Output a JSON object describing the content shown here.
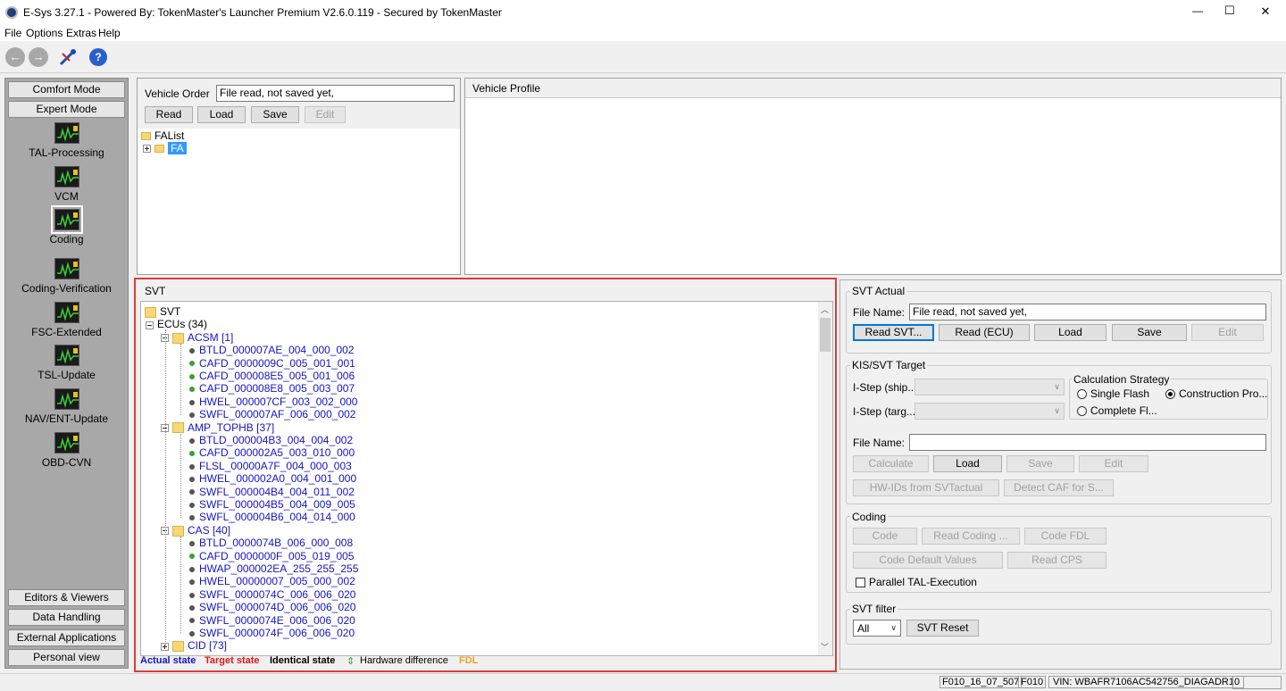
{
  "window": {
    "title": "E-Sys 3.27.1 - Powered By: TokenMaster's Launcher Premium V2.6.0.119 - Secured by TokenMaster",
    "minimize": "—",
    "maximize": "☐",
    "close": "✕"
  },
  "menu": [
    "File",
    "Options",
    "Extras",
    "Help"
  ],
  "sidebar": {
    "top_tabs": [
      "Comfort Mode",
      "Expert Mode"
    ],
    "modes": [
      "TAL-Processing",
      "VCM",
      "Coding",
      "Coding-Verification",
      "FSC-Extended",
      "TSL-Update",
      "NAV/ENT-Update",
      "OBD-CVN"
    ],
    "selected_mode": "Coding",
    "bottom_tabs": [
      "Editors & Viewers",
      "Data Handling",
      "External Applications",
      "Personal view"
    ]
  },
  "vehicle_order": {
    "label": "Vehicle Order",
    "value": "File read, not saved yet,",
    "buttons": {
      "read": "Read",
      "load": "Load",
      "save": "Save",
      "edit": "Edit"
    },
    "tree": {
      "root": "FAList",
      "child": "FA"
    }
  },
  "vehicle_profile": {
    "title": "Vehicle Profile"
  },
  "svt": {
    "title": "SVT",
    "root": "SVT",
    "ecus_label": "ECUs (34)",
    "groups": [
      {
        "name": "ACSM [1]",
        "items": [
          {
            "text": "BTLD_000007AE_004_000_002",
            "dot": "dark"
          },
          {
            "text": "CAFD_0000009C_005_001_001",
            "dot": "green"
          },
          {
            "text": "CAFD_000008E5_005_001_006",
            "dot": "green"
          },
          {
            "text": "CAFD_000008E8_005_003_007",
            "dot": "green"
          },
          {
            "text": "HWEL_000007CF_003_002_000",
            "dot": "dark"
          },
          {
            "text": "SWFL_000007AF_006_000_002",
            "dot": "dark"
          }
        ]
      },
      {
        "name": "AMP_TOPHB [37]",
        "items": [
          {
            "text": "BTLD_000004B3_004_004_002",
            "dot": "dark"
          },
          {
            "text": "CAFD_000002A5_003_010_000",
            "dot": "green"
          },
          {
            "text": "FLSL_00000A7F_004_000_003",
            "dot": "dark"
          },
          {
            "text": "HWEL_000002A0_004_001_000",
            "dot": "dark"
          },
          {
            "text": "SWFL_000004B4_004_011_002",
            "dot": "dark"
          },
          {
            "text": "SWFL_000004B5_004_009_005",
            "dot": "dark"
          },
          {
            "text": "SWFL_000004B6_004_014_000",
            "dot": "dark"
          }
        ]
      },
      {
        "name": "CAS [40]",
        "items": [
          {
            "text": "BTLD_0000074B_006_000_008",
            "dot": "dark"
          },
          {
            "text": "CAFD_0000000F_005_019_005",
            "dot": "green"
          },
          {
            "text": "HWAP_000002EA_255_255_255",
            "dot": "dark"
          },
          {
            "text": "HWEL_00000007_005_000_002",
            "dot": "dark"
          },
          {
            "text": "SWFL_0000074C_006_006_020",
            "dot": "dark"
          },
          {
            "text": "SWFL_0000074D_006_006_020",
            "dot": "dark"
          },
          {
            "text": "SWFL_0000074E_006_006_020",
            "dot": "dark"
          },
          {
            "text": "SWFL_0000074F_006_006_020",
            "dot": "dark"
          }
        ]
      },
      {
        "name": "CID [73]",
        "items": []
      }
    ],
    "legend": {
      "actual": "Actual state",
      "target": "Target state",
      "identical": "Identical state",
      "hw_diff": "Hardware difference",
      "fdl": "FDL",
      "colors": {
        "actual": "#1414c8",
        "target": "#e01818",
        "identical": "#000000",
        "fdl": "#f0a020"
      }
    }
  },
  "svt_actual": {
    "title": "SVT Actual",
    "file_label": "File Name:",
    "file_value": "File read, not saved yet,",
    "buttons": {
      "read_svt": "Read SVT...",
      "read_ecu": "Read (ECU)",
      "load": "Load",
      "save": "Save",
      "edit": "Edit"
    }
  },
  "kis_target": {
    "title": "KIS/SVT Target",
    "istep_ship": "I-Step (ship...",
    "istep_targ": "I-Step (targ...",
    "calc_title": "Calculation Strategy",
    "calc_options": {
      "single": "Single Flash",
      "construction": "Construction Pro...",
      "complete": "Complete Fl..."
    },
    "file_label": "File Name:",
    "file_value": "",
    "buttons": {
      "calculate": "Calculate",
      "load": "Load",
      "save": "Save",
      "edit": "Edit",
      "hwids": "HW-IDs from SVTactual",
      "detect": "Detect CAF for S..."
    }
  },
  "coding": {
    "title": "Coding",
    "buttons": {
      "code": "Code",
      "read_coding": "Read Coding ...",
      "code_fdl": "Code FDL",
      "code_default": "Code Default Values",
      "read_cps": "Read CPS"
    },
    "parallel": "Parallel TAL-Execution"
  },
  "svt_filter": {
    "title": "SVT filter",
    "selected": "All",
    "reset": "SVT Reset"
  },
  "status_bar": [
    "F010_16_07_507",
    "F010",
    "VIN: WBAFR7106AC542756_DIAGADR10"
  ]
}
